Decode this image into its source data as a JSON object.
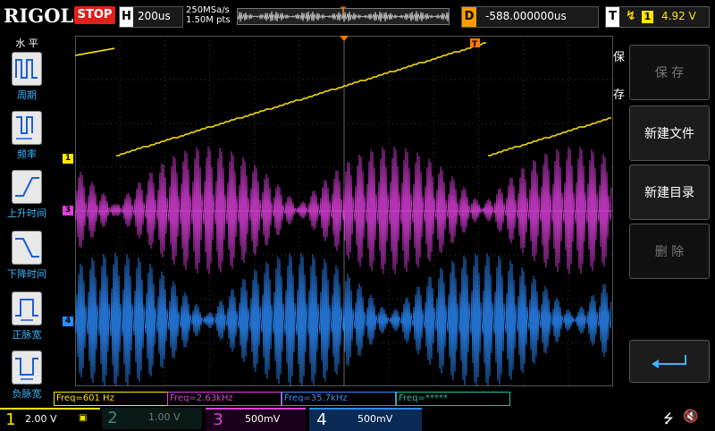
{
  "brand": "RIGOL",
  "run_state": "STOP",
  "timebase": {
    "label": "H",
    "value": "200us"
  },
  "sample": {
    "rate": "250MSa/s",
    "points": "1.50M pts"
  },
  "delay": {
    "label": "D",
    "value": "-588.000000us"
  },
  "trigger": {
    "label": "T",
    "slope": "↯",
    "source": "1",
    "level": "4.92 V"
  },
  "left_menu": {
    "title": "水 平",
    "items": [
      {
        "label": "周期",
        "icon": "period-icon"
      },
      {
        "label": "频率",
        "icon": "frequency-icon"
      },
      {
        "label": "上升时间",
        "icon": "rise-time-icon"
      },
      {
        "label": "下降时间",
        "icon": "fall-time-icon"
      },
      {
        "label": "正脉宽",
        "icon": "positive-width-icon"
      },
      {
        "label": "负脉宽",
        "icon": "negative-width-icon"
      }
    ]
  },
  "right_menu": {
    "title_top": "保",
    "title_bottom": "存",
    "buttons": [
      {
        "label": "保 存",
        "enabled": false
      },
      {
        "label": "新建文件",
        "enabled": true
      },
      {
        "label": "新建目录",
        "enabled": true
      },
      {
        "label": "删 除",
        "enabled": false
      }
    ],
    "enter_icon": "enter-icon"
  },
  "freq_readouts": [
    {
      "text": "Freq=601 Hz",
      "color": "#ffe600"
    },
    {
      "text": "Freq=2.63kHz",
      "color": "#e040e0"
    },
    {
      "text": "Freq=35.7kHz",
      "color": "#3c8cff"
    },
    {
      "text": "Freq=*****",
      "color": "#20c0a0"
    }
  ],
  "channels": [
    {
      "num": "1",
      "scale": "2.00 V",
      "color": "#ffe600",
      "active": true
    },
    {
      "num": "2",
      "scale": "1.00 V",
      "color": "#20c0a0",
      "active": false
    },
    {
      "num": "3",
      "scale": "500mV",
      "color": "#e040e0",
      "active": true
    },
    {
      "num": "4",
      "scale": "500mV",
      "color": "#2b8cff",
      "active": true
    }
  ],
  "channel_markers": [
    "1",
    "3",
    "4"
  ],
  "status_icons": [
    "usb-icon",
    "speaker-muted-icon"
  ],
  "colors": {
    "ch1": "#ffe600",
    "ch3": "#e040e0",
    "ch4": "#2b8cff",
    "trigger": "#ff7a00",
    "grid": "#3a3a3a"
  }
}
